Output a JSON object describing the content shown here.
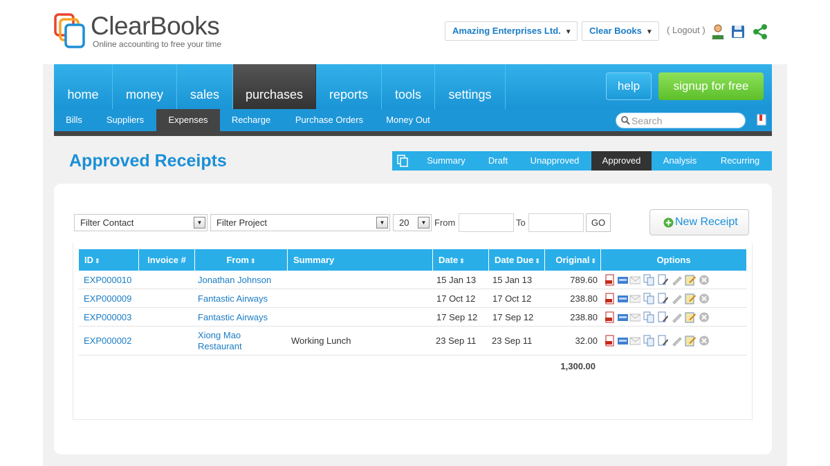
{
  "header": {
    "brand": "ClearBooks",
    "tagline": "Online accounting to free your time",
    "company_select": "Amazing Enterprises Ltd.",
    "product_select": "Clear Books",
    "logout_prefix": "(",
    "logout_label": "Logout",
    "logout_suffix": ")",
    "caret": "▼"
  },
  "nav": {
    "items": [
      "home",
      "money",
      "sales",
      "purchases",
      "reports",
      "tools",
      "settings"
    ],
    "active": "purchases",
    "help_label": "help",
    "signup_label": "signup for free"
  },
  "subnav": {
    "items": [
      "Bills",
      "Suppliers",
      "Expenses",
      "Recharge",
      "Purchase Orders",
      "Money Out"
    ],
    "active": "Expenses",
    "search_placeholder": "Search"
  },
  "page": {
    "title": "Approved Receipts"
  },
  "status_tabs": {
    "items": [
      "Summary",
      "Draft",
      "Unapproved",
      "Approved",
      "Analysis",
      "Recurring"
    ],
    "active": "Approved"
  },
  "filters": {
    "contact": "Filter Contact",
    "project": "Filter Project",
    "per_page": "20",
    "from_label": "From",
    "to_label": "To",
    "from_value": "",
    "to_value": "",
    "go_label": "GO",
    "new_receipt_label": "New Receipt"
  },
  "table": {
    "headers": {
      "id": "ID",
      "invoice": "Invoice #",
      "from": "From",
      "summary": "Summary",
      "date": "Date",
      "date_due": "Date Due",
      "original": "Original",
      "options": "Options"
    },
    "sort_glyph": "⇕",
    "rows": [
      {
        "id": "EXP000010",
        "invoice": "",
        "from": "Jonathan Johnson",
        "summary": "",
        "date": "15 Jan 13",
        "date_due": "15 Jan 13",
        "original": "789.60"
      },
      {
        "id": "EXP000009",
        "invoice": "",
        "from": "Fantastic Airways",
        "summary": "",
        "date": "17 Oct 12",
        "date_due": "17 Oct 12",
        "original": "238.80"
      },
      {
        "id": "EXP000003",
        "invoice": "",
        "from": "Fantastic Airways",
        "summary": "",
        "date": "17 Sep 12",
        "date_due": "17 Sep 12",
        "original": "238.80"
      },
      {
        "id": "EXP000002",
        "invoice": "",
        "from": "Xiong Mao Restaurant",
        "summary": "Working Lunch",
        "date": "23 Sep 11",
        "date_due": "23 Sep 11",
        "original": "32.00"
      }
    ],
    "total": "1,300.00",
    "option_icons": [
      "pdf-icon",
      "html-icon",
      "email-icon",
      "copy-icon",
      "edit-document-icon",
      "attachment-icon",
      "notes-icon",
      "delete-icon"
    ]
  },
  "colors": {
    "brand_blue": "#1a8fd6",
    "nav_blue": "#2aaee8",
    "signup_green": "#5cbf2a",
    "active_dark": "#333333"
  }
}
